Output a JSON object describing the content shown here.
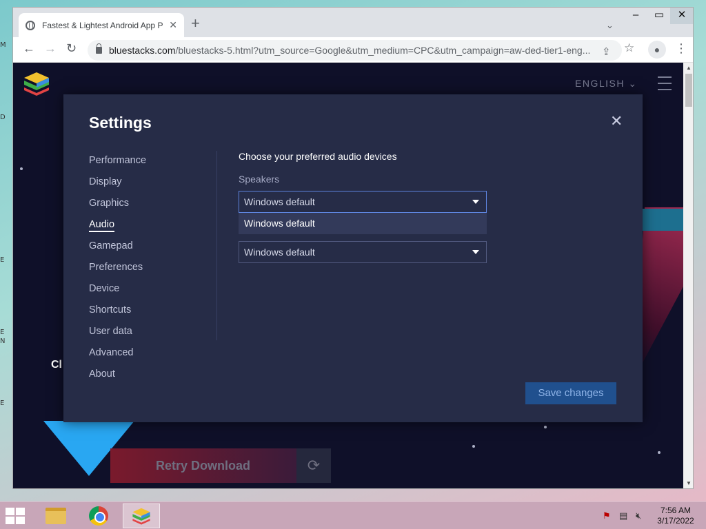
{
  "browser": {
    "tab_title": "Fastest & Lightest Android App P",
    "new_tab": "+",
    "url_host": "bluestacks.com",
    "url_rest": "/bluestacks-5.html?utm_source=Google&utm_medium=CPC&utm_campaign=aw-ded-tier1-eng..."
  },
  "page": {
    "language": "ENGLISH",
    "click_text": "Cl",
    "retry_label": "Retry Download"
  },
  "settings": {
    "title": "Settings",
    "nav": [
      "Performance",
      "Display",
      "Graphics",
      "Audio",
      "Gamepad",
      "Preferences",
      "Device",
      "Shortcuts",
      "User data",
      "Advanced",
      "About"
    ],
    "active_nav": "Audio",
    "section_heading": "Choose your preferred audio devices",
    "speakers_label": "Speakers",
    "speakers_value": "Windows default",
    "dropdown_options": [
      "Windows default"
    ],
    "microphone_value": "Windows default",
    "save_label": "Save changes"
  },
  "taskbar": {
    "time": "7:56 AM",
    "date": "3/17/2022"
  },
  "desktop": {
    "edge_letters": [
      "M",
      "D",
      "E",
      "E",
      "N",
      "E"
    ]
  },
  "colors": {
    "modal_bg": "#262c47",
    "page_bg": "#0f1029",
    "accent_blue": "#29a7f2",
    "save_btn": "#20508e"
  }
}
